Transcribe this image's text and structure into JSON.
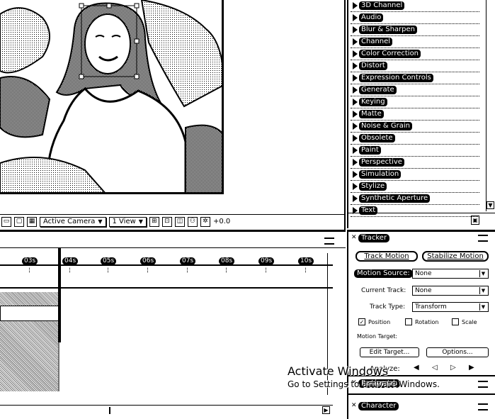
{
  "viewer": {
    "toolbar": {
      "camera_label": "Active Camera",
      "view_label": "1 View",
      "exposure_value": "+0.0"
    }
  },
  "effects_panel": {
    "categories": [
      "3D Channel",
      "Audio",
      "Blur & Sharpen",
      "Channel",
      "Color Correction",
      "Distort",
      "Expression Controls",
      "Generate",
      "Keying",
      "Matte",
      "Noise & Grain",
      "Obsolete",
      "Paint",
      "Perspective",
      "Simulation",
      "Stylize",
      "Synthetic Aperture",
      "Text"
    ]
  },
  "timeline": {
    "ticks": [
      "03s",
      "04s",
      "05s",
      "06s",
      "07s",
      "08s",
      "09s",
      "10s"
    ]
  },
  "tracker": {
    "tab_label": "Tracker",
    "track_motion_label": "Track Motion",
    "stabilize_motion_label": "Stabilize Motion",
    "motion_source_label": "Motion Source:",
    "motion_source_value": "None",
    "current_track_label": "Current Track:",
    "current_track_value": "None",
    "track_type_label": "Track Type:",
    "track_type_value": "Transform",
    "position_label": "Position",
    "rotation_label": "Rotation",
    "scale_label": "Scale",
    "motion_target_label": "Motion Target:",
    "edit_target_label": "Edit Target...",
    "options_label": "Options...",
    "analyze_label": "Analyze:",
    "paragraph_tab_label": "Paragraph",
    "character_tab_label": "Character"
  },
  "watermark": {
    "title": "Activate Windows",
    "subtitle": "Go to Settings to activate Windows."
  }
}
